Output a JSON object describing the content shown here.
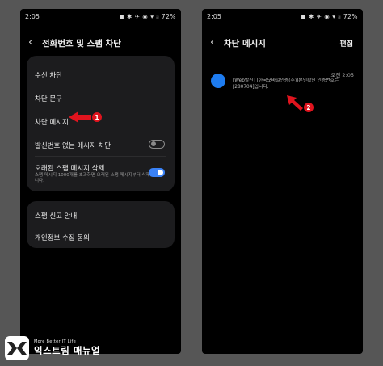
{
  "left_screen": {
    "status": {
      "time": "2:05",
      "icons_text": "◼ ✱ ✈ ◉ ▾ ᵢₗ 72%"
    },
    "header": {
      "title": "전화번호 및 스팸 차단"
    },
    "card1": {
      "items": [
        {
          "label": "수신 차단"
        },
        {
          "label": "차단 문구"
        },
        {
          "label": "차단 메시지"
        },
        {
          "label": "발신번호 없는 메시지 차단",
          "toggle": "off"
        },
        {
          "label": "오래된 스팸 메시지 삭제",
          "sub": "스팸 메시지 1000개를 초과하면 오래된 스팸 메시지부터 삭제합니다.",
          "toggle": "on"
        }
      ]
    },
    "card2": {
      "items": [
        {
          "label": "스팸 신고 안내"
        },
        {
          "label": "개인정보 수집 동의"
        }
      ]
    },
    "annotation": "1"
  },
  "right_screen": {
    "status": {
      "time": "2:05",
      "icons_text": "◼ ✱ ✈ ◉ ▾ ᵢₗ 72%"
    },
    "header": {
      "title": "차단 메시지",
      "action": "편집"
    },
    "message": {
      "time": "오전 2:05",
      "text": "[Web발신] [한국모바일인증(주)]본인확인 인증번호는 [280704]입니다."
    },
    "annotation": "2"
  },
  "watermark": {
    "tagline": "More Better IT Life",
    "name": "익스트림 매뉴얼",
    "logo_mark": "EX"
  },
  "colors": {
    "accent": "#3a82f7",
    "badge": "#e0141e",
    "avatar": "#1e7cf0"
  }
}
